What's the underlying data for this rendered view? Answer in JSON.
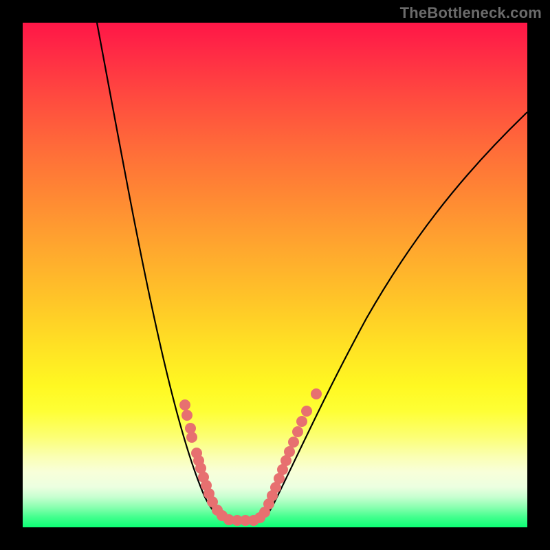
{
  "watermark": "TheBottleneck.com",
  "chart_data": {
    "type": "line",
    "title": "",
    "xlabel": "",
    "ylabel": "",
    "xlim": [
      0,
      100
    ],
    "ylim": [
      0,
      100
    ],
    "background_gradient": {
      "orientation": "vertical",
      "stops": [
        {
          "pos": 0.0,
          "color": "#ff1647"
        },
        {
          "pos": 0.25,
          "color": "#ff6c39"
        },
        {
          "pos": 0.55,
          "color": "#ffc528"
        },
        {
          "pos": 0.78,
          "color": "#feff35"
        },
        {
          "pos": 0.92,
          "color": "#ecffe0"
        },
        {
          "pos": 1.0,
          "color": "#0cff75"
        }
      ]
    },
    "series": [
      {
        "name": "bottleneck-curve",
        "x": [
          15,
          20,
          25,
          30,
          33,
          36,
          38,
          40,
          42,
          44,
          46,
          50,
          55,
          60,
          68,
          80,
          100
        ],
        "y": [
          100,
          77,
          55,
          33,
          20,
          10,
          5,
          2,
          1,
          1,
          1,
          5,
          14,
          25,
          40,
          58,
          82
        ]
      }
    ],
    "scatter": [
      {
        "name": "highlighted-points",
        "color": "#e77070",
        "points": [
          {
            "x": 32,
            "y": 24
          },
          {
            "x": 32.5,
            "y": 22
          },
          {
            "x": 33,
            "y": 20
          },
          {
            "x": 33.5,
            "y": 18
          },
          {
            "x": 34.5,
            "y": 15
          },
          {
            "x": 35,
            "y": 13
          },
          {
            "x": 35.5,
            "y": 11.5
          },
          {
            "x": 36,
            "y": 10
          },
          {
            "x": 36.5,
            "y": 8
          },
          {
            "x": 37,
            "y": 6.5
          },
          {
            "x": 37.5,
            "y": 5
          },
          {
            "x": 38.5,
            "y": 3.5
          },
          {
            "x": 39.5,
            "y": 2
          },
          {
            "x": 41,
            "y": 1
          },
          {
            "x": 42.5,
            "y": 1
          },
          {
            "x": 44,
            "y": 1
          },
          {
            "x": 45.5,
            "y": 1
          },
          {
            "x": 47,
            "y": 2
          },
          {
            "x": 48,
            "y": 3
          },
          {
            "x": 48.7,
            "y": 4.5
          },
          {
            "x": 49.5,
            "y": 6
          },
          {
            "x": 50,
            "y": 8
          },
          {
            "x": 50.8,
            "y": 9.5
          },
          {
            "x": 51.5,
            "y": 11.5
          },
          {
            "x": 52,
            "y": 13
          },
          {
            "x": 52.8,
            "y": 15
          },
          {
            "x": 53.7,
            "y": 17
          },
          {
            "x": 54.5,
            "y": 19
          },
          {
            "x": 55.3,
            "y": 21
          },
          {
            "x": 56.2,
            "y": 23
          },
          {
            "x": 58.2,
            "y": 26.5
          }
        ]
      }
    ]
  }
}
